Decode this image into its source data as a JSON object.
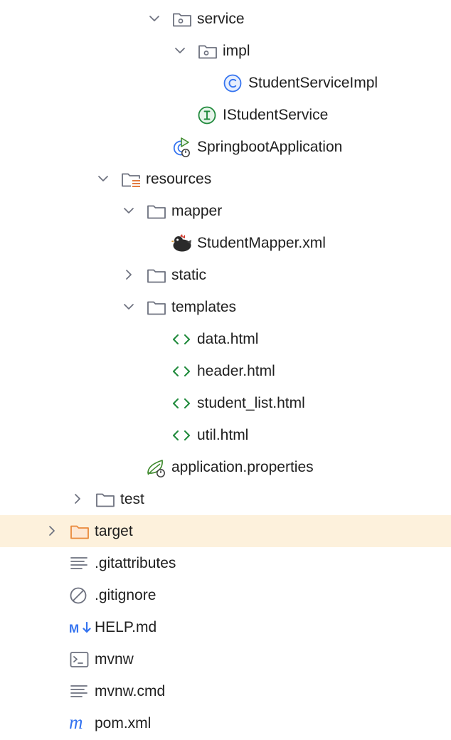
{
  "project_tree": {
    "items": [
      {
        "label": "service",
        "icon": "package-folder-icon",
        "depth": 4,
        "arrow": "expanded"
      },
      {
        "label": "impl",
        "icon": "package-folder-icon",
        "depth": 5,
        "arrow": "expanded"
      },
      {
        "label": "StudentServiceImpl",
        "icon": "class-icon",
        "depth": 6,
        "arrow": "none"
      },
      {
        "label": "IStudentService",
        "icon": "interface-icon",
        "depth": 5,
        "arrow": "none"
      },
      {
        "label": "SpringbootApplication",
        "icon": "spring-boot-class-icon",
        "depth": 4,
        "arrow": "none"
      },
      {
        "label": "resources",
        "icon": "resources-folder-icon",
        "depth": 2,
        "arrow": "expanded"
      },
      {
        "label": "mapper",
        "icon": "folder-icon",
        "depth": 3,
        "arrow": "expanded"
      },
      {
        "label": "StudentMapper.xml",
        "icon": "mybatis-bird-icon",
        "depth": 4,
        "arrow": "none"
      },
      {
        "label": "static",
        "icon": "folder-icon",
        "depth": 3,
        "arrow": "collapsed"
      },
      {
        "label": "templates",
        "icon": "folder-icon",
        "depth": 3,
        "arrow": "expanded"
      },
      {
        "label": "data.html",
        "icon": "html-file-icon",
        "depth": 4,
        "arrow": "none"
      },
      {
        "label": "header.html",
        "icon": "html-file-icon",
        "depth": 4,
        "arrow": "none"
      },
      {
        "label": "student_list.html",
        "icon": "html-file-icon",
        "depth": 4,
        "arrow": "none"
      },
      {
        "label": "util.html",
        "icon": "html-file-icon",
        "depth": 4,
        "arrow": "none"
      },
      {
        "label": "application.properties",
        "icon": "spring-properties-icon",
        "depth": 3,
        "arrow": "none"
      },
      {
        "label": "test",
        "icon": "folder-icon",
        "depth": 1,
        "arrow": "collapsed"
      },
      {
        "label": "target",
        "icon": "excluded-folder-icon",
        "depth": 0,
        "arrow": "collapsed",
        "selected": true
      },
      {
        "label": ".gitattributes",
        "icon": "text-file-icon",
        "depth": 0,
        "arrow": "none"
      },
      {
        "label": ".gitignore",
        "icon": "ignore-file-icon",
        "depth": 0,
        "arrow": "none"
      },
      {
        "label": "HELP.md",
        "icon": "markdown-icon",
        "depth": 0,
        "arrow": "none"
      },
      {
        "label": "mvnw",
        "icon": "shell-script-icon",
        "depth": 0,
        "arrow": "none"
      },
      {
        "label": "mvnw.cmd",
        "icon": "text-file-icon",
        "depth": 0,
        "arrow": "none"
      },
      {
        "label": "pom.xml",
        "icon": "maven-icon",
        "depth": 0,
        "arrow": "none"
      }
    ]
  },
  "colors": {
    "selection_background": "#fdf1dc",
    "folder_stroke": "#6c707e",
    "excluded_folder_stroke": "#e9883a",
    "class_icon": "#3574f0",
    "interface_icon": "#208a3c",
    "html_icon": "#208a3c",
    "spring_icon": "#3f8a2e",
    "markdown_icon": "#3574f0",
    "maven_icon": "#3574f0",
    "resources_lines": "#e06d2e"
  }
}
